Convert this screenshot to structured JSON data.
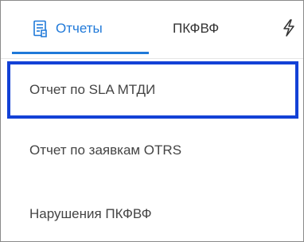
{
  "tabs": [
    {
      "label": "Отчеты",
      "icon": "report-icon",
      "active": true
    },
    {
      "label": "ПКФВФ",
      "icon": null,
      "active": false
    },
    {
      "label": "",
      "icon": "lightning-icon",
      "active": false
    }
  ],
  "menu": {
    "items": [
      {
        "label": "Отчет по SLA МТДИ",
        "selected": true
      },
      {
        "label": "Отчет по заявкам OTRS",
        "selected": false
      },
      {
        "label": "Нарушения ПКФВФ",
        "selected": false
      }
    ]
  },
  "colors": {
    "accent": "#1f79d9",
    "selection_border": "#1341d6",
    "text": "#444444"
  }
}
